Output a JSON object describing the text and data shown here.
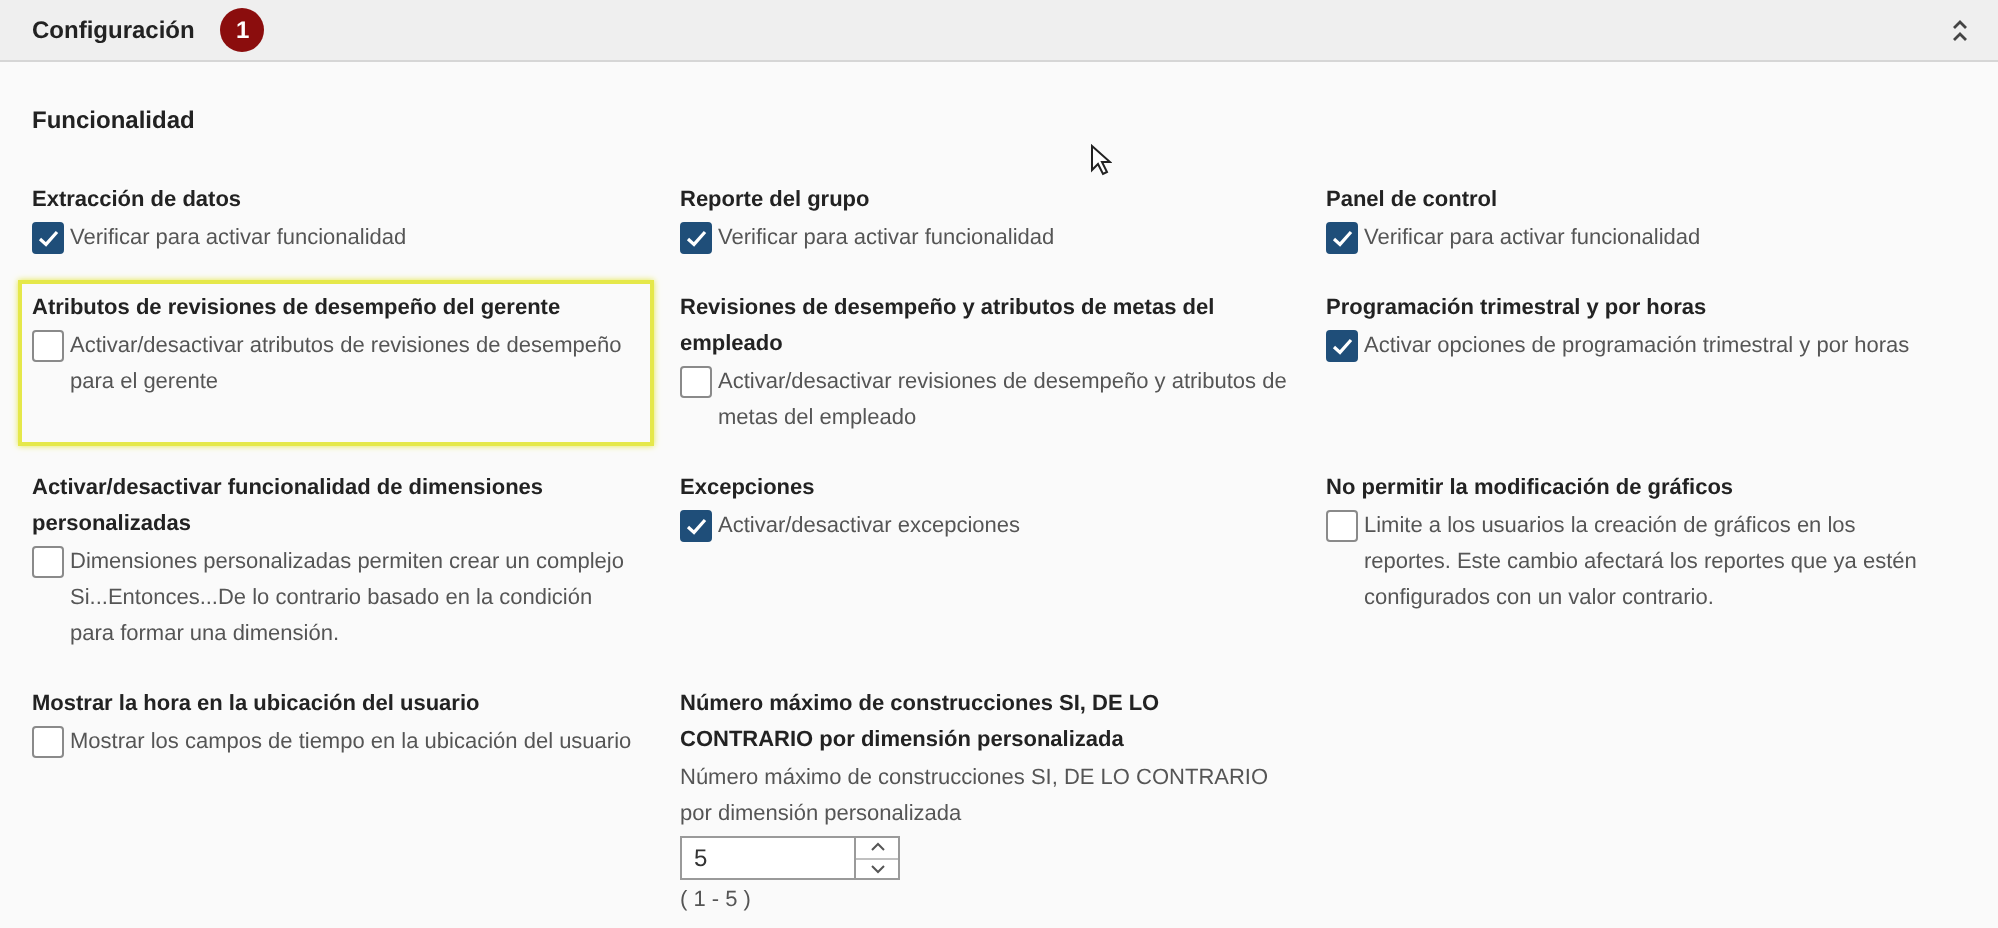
{
  "panel": {
    "title": "Configuración",
    "badge": "1",
    "expanded": true
  },
  "section": {
    "title": "Funcionalidad"
  },
  "settings": [
    {
      "kind": "checkbox",
      "label": "Extracción de datos",
      "description": "Verificar para activar funcionalidad",
      "checked": true,
      "highlighted": false
    },
    {
      "kind": "checkbox",
      "label": "Reporte del grupo",
      "description": "Verificar para activar funcionalidad",
      "checked": true,
      "highlighted": false
    },
    {
      "kind": "checkbox",
      "label": "Panel de control",
      "description": "Verificar para activar funcionalidad",
      "checked": true,
      "highlighted": false
    },
    {
      "kind": "checkbox",
      "label": "Atributos de revisiones de desempeño del gerente",
      "description": "Activar/desactivar atributos de revisiones de desempeño para el gerente",
      "checked": false,
      "highlighted": true
    },
    {
      "kind": "checkbox",
      "label": "Revisiones de desempeño y atributos de metas del empleado",
      "description": "Activar/desactivar revisiones de desempeño y atributos de metas del empleado",
      "checked": false,
      "highlighted": false
    },
    {
      "kind": "checkbox",
      "label": "Programación trimestral y por horas",
      "description": "Activar opciones de programación trimestral y por horas",
      "checked": true,
      "highlighted": false
    },
    {
      "kind": "checkbox",
      "label": "Activar/desactivar funcionalidad de dimensiones personalizadas",
      "description": "Dimensiones personalizadas permiten crear un complejo Si...Entonces...De lo contrario basado en la condición para formar una dimensión.",
      "checked": false,
      "highlighted": false
    },
    {
      "kind": "checkbox",
      "label": "Excepciones",
      "description": "Activar/desactivar excepciones",
      "checked": true,
      "highlighted": false
    },
    {
      "kind": "checkbox",
      "label": "No permitir la modificación de gráficos",
      "description": "Limite a los usuarios la creación de gráficos en los reportes. Este cambio afectará los reportes que ya estén configurados con un valor contrario.",
      "checked": false,
      "highlighted": false
    },
    {
      "kind": "checkbox",
      "label": "Mostrar la hora en la ubicación del usuario",
      "description": "Mostrar los campos de tiempo en la ubicación del usuario",
      "checked": false,
      "highlighted": false
    },
    {
      "kind": "number",
      "label": "Número máximo de construcciones SI, DE LO CONTRARIO por dimensión personalizada",
      "description": "Número máximo de construcciones SI, DE LO CONTRARIO por dimensión personalizada",
      "value": "5",
      "range": "( 1 - 5 )",
      "highlighted": false
    }
  ]
}
